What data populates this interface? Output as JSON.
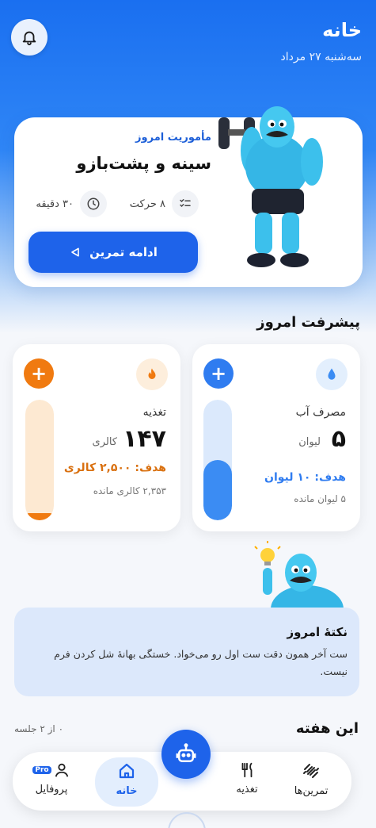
{
  "header": {
    "title": "خانه",
    "date": "سه‌شنبه ۲۷ مرداد"
  },
  "mission": {
    "label": "مأموریت امروز",
    "title": "سینه و پشت‌بازو",
    "moves": "۸ حرکت",
    "duration": "۳۰ دقیقه",
    "cta": "ادامه تمرین"
  },
  "progress": {
    "title": "پیشرفت امروز",
    "water": {
      "name": "مصرف آب",
      "value": "۵",
      "unit": "لیوان",
      "goal": "هدف: ۱۰ لیوان",
      "remaining": "۵ لیوان مانده",
      "fraction": 0.5,
      "color": "#3b8cf3",
      "track": "#dbe9fc"
    },
    "food": {
      "name": "تغذیه",
      "value": "۱۴۷",
      "unit": "کالری",
      "goal": "هدف: ۲,۵۰۰ کالری",
      "remaining": "۲,۳۵۳ کالری مانده",
      "fraction": 0.06,
      "color": "#f07a10",
      "track": "#fde9d2"
    }
  },
  "tip": {
    "title": "نکتهٔ امروز",
    "text": "ست آخر همون دقت ست اول رو می‌خواد. خستگی بهانهٔ شل کردن فرم نیست."
  },
  "week": {
    "title": "این هفته",
    "count": "۰ از ۲ جلسه"
  },
  "nav": {
    "profile": "پروفایل",
    "pro": "Pro",
    "home": "خانه",
    "nutrition": "تغذیه",
    "workouts": "تمرین‌ها"
  }
}
